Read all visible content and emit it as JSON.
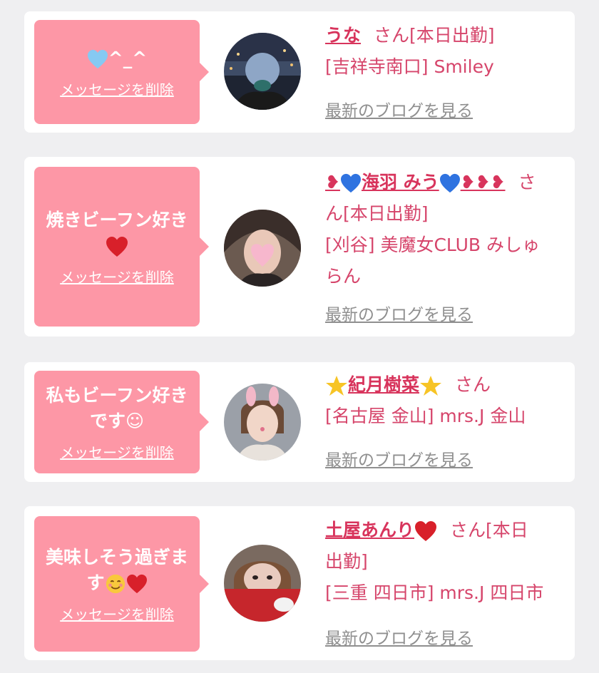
{
  "delete_label": "メッセージを削除",
  "blog_label": "最新のブログを見る",
  "san": "さん",
  "colors": {
    "background": "#efeff1",
    "bubble": "#fd97a6",
    "accent": "#d6456b",
    "link_gray": "#8f8f8f"
  },
  "cards": [
    {
      "message": "^_^",
      "message_icons": [
        "light-blue-heart-icon"
      ],
      "name": "うな",
      "status": "[本日出勤]",
      "shop": "[吉祥寺南口] Smiley"
    },
    {
      "message": "焼きビーフン好き",
      "message_icons": [
        "red-heart-icon"
      ],
      "name_prefix": "❥",
      "name": "海羽 みう",
      "name_suffix": "❥❥❥",
      "name_icons": [
        "blue-heart-icon"
      ],
      "status": "[本日出勤]",
      "shop_line1": "[刈谷] 美魔女CLUB みしゅ",
      "shop_line2": "らん"
    },
    {
      "message_line1": "私もビーフン好き",
      "message_line2": "です☺",
      "name": "紀月樹菜",
      "name_icons": [
        "glowing-star-icon"
      ],
      "shop": "[名古屋 金山] mrs.J 金山"
    },
    {
      "message_line1": "美味しそう過ぎま",
      "message_line2": "す",
      "message_icons": [
        "smiling-face-with-hearts-icon",
        "red-heart-icon"
      ],
      "name": "土屋あんり",
      "name_icons": [
        "red-heart-icon"
      ],
      "status_part1": "[本日",
      "status_part2": "出勤]",
      "shop": "[三重 四日市] mrs.J 四日市"
    }
  ]
}
